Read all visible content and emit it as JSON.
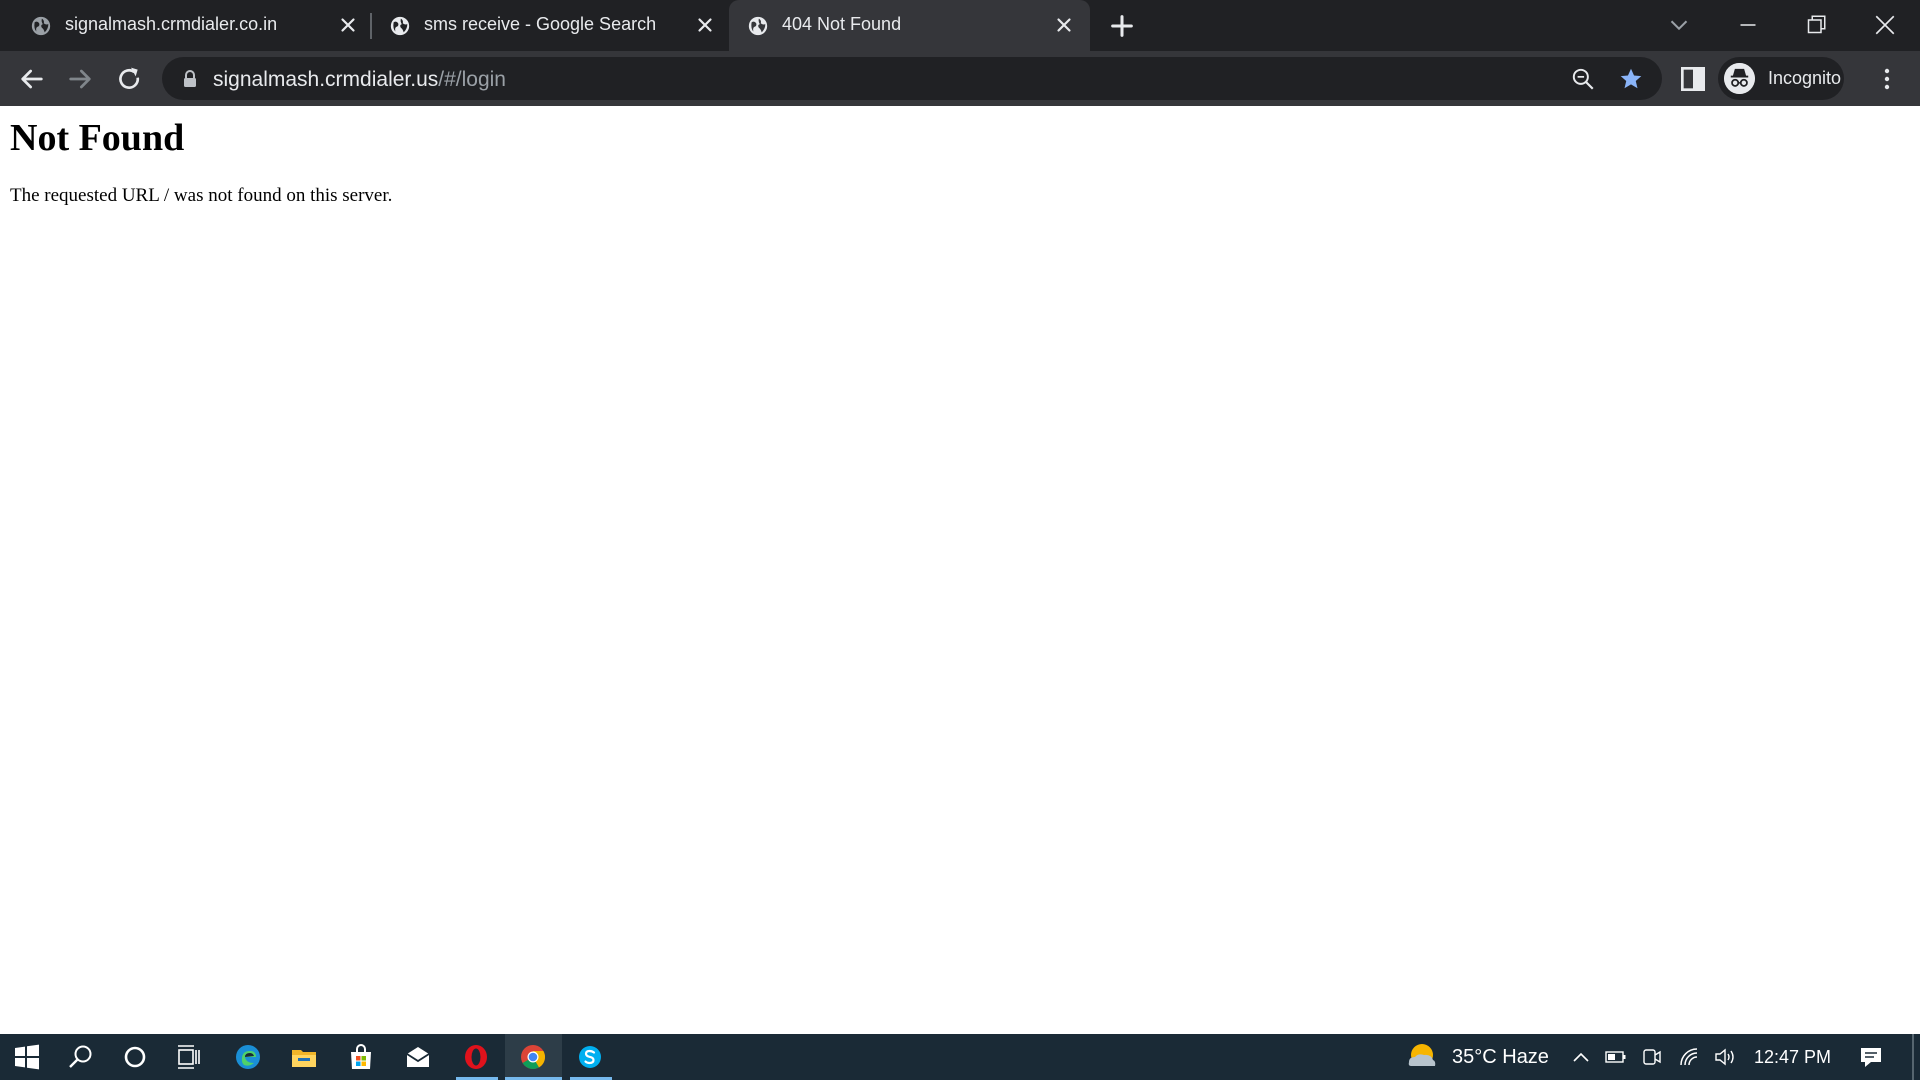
{
  "browser": {
    "tabs": [
      {
        "title": "signalmash.crmdialer.co.in",
        "favicon": "globe-icon",
        "active": false
      },
      {
        "title": "sms receive - Google Search",
        "favicon": "globe-icon",
        "active": false
      },
      {
        "title": "404 Not Found",
        "favicon": "globe-icon",
        "active": true
      }
    ],
    "address": {
      "host": "signalmash.crmdialer.us",
      "path": "/#/login"
    },
    "profile_label": "Incognito"
  },
  "page": {
    "heading": "Not Found",
    "message": "The requested URL / was not found on this server."
  },
  "taskbar": {
    "weather": "35°C  Haze",
    "clock": "12:47 PM"
  },
  "colors": {
    "tabstrip": "#202124",
    "toolbar": "#35363a",
    "accent_star": "#8ab4f8",
    "taskbar": "#1a2a36",
    "taskbar_indicator": "#76b9ed"
  }
}
